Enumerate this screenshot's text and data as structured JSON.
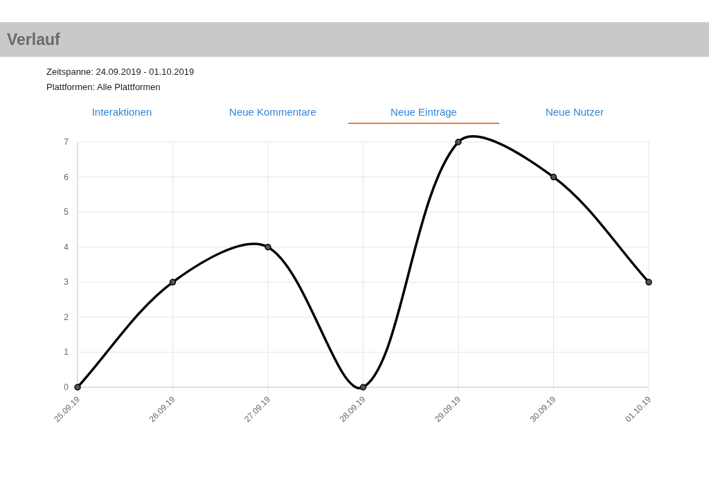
{
  "header": {
    "title": "Verlauf"
  },
  "info": [
    "Zeitspanne: 24.09.2019 - 01.10.2019",
    "Plattformen: Alle Plattformen"
  ],
  "tabs": [
    {
      "label": "Interaktionen",
      "selected": false
    },
    {
      "label": "Neue Kommentare",
      "selected": false
    },
    {
      "label": "Neue Einträge",
      "selected": true
    },
    {
      "label": "Neue Nutzer",
      "selected": false
    }
  ],
  "chart_data": {
    "type": "line",
    "categories": [
      "25.09.19",
      "26.09.19",
      "27.09.19",
      "28.09.19",
      "29.09.19",
      "30.09.19",
      "01.10.19"
    ],
    "series": [
      {
        "color": "#000000",
        "marker": true,
        "values": [
          0,
          3,
          4,
          0,
          7,
          6,
          3
        ]
      }
    ],
    "ylim": [
      0,
      7
    ],
    "yticks": [
      0,
      1,
      2,
      3,
      4,
      5,
      6,
      7
    ],
    "grid": true
  }
}
